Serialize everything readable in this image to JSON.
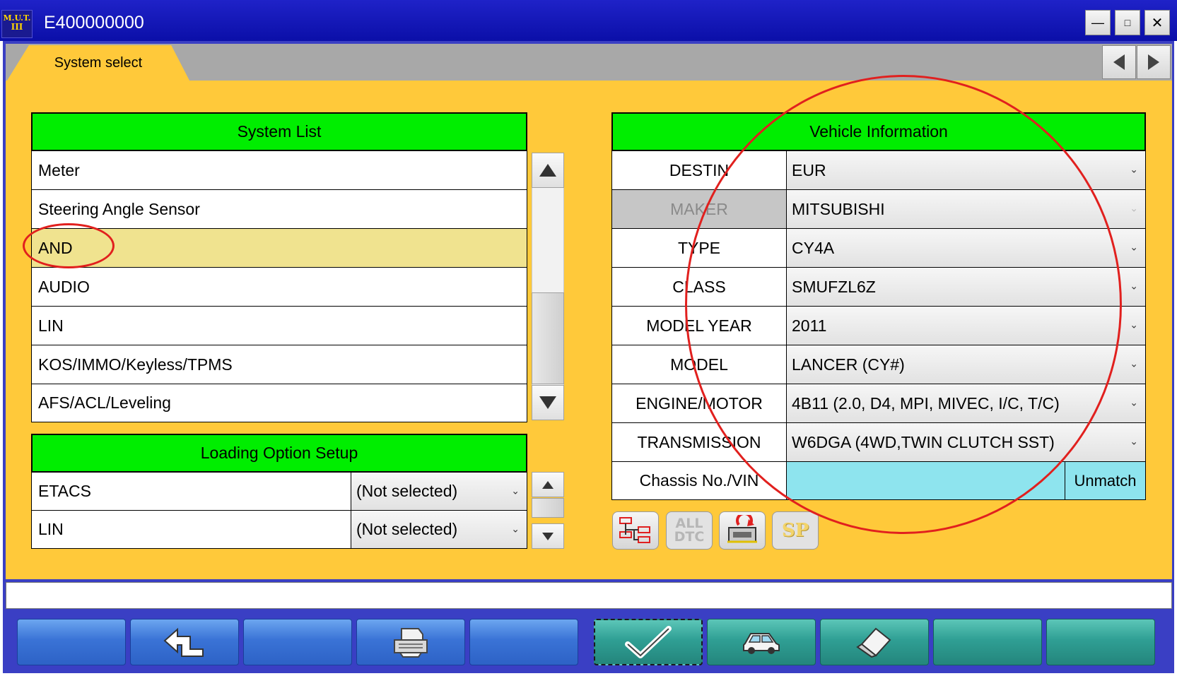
{
  "window": {
    "icon_text_line1": "M.U.T.",
    "icon_text_line2": "III",
    "title": "E400000000",
    "minimize": "—",
    "maximize": "□",
    "close": "✕"
  },
  "tab": {
    "label": "System select"
  },
  "system_list": {
    "header": "System List",
    "items": [
      {
        "label": "Meter"
      },
      {
        "label": "Steering Angle Sensor"
      },
      {
        "label": "AND",
        "selected": true
      },
      {
        "label": "AUDIO"
      },
      {
        "label": "LIN"
      },
      {
        "label": "KOS/IMMO/Keyless/TPMS"
      },
      {
        "label": "AFS/ACL/Leveling"
      }
    ]
  },
  "loading_option": {
    "header": "Loading Option Setup",
    "rows": [
      {
        "label": "ETACS",
        "value": "(Not selected)"
      },
      {
        "label": "LIN",
        "value": "(Not selected)"
      }
    ]
  },
  "vehicle_info": {
    "header": "Vehicle Information",
    "fields": [
      {
        "label": "DESTIN",
        "value": "EUR"
      },
      {
        "label": "MAKER",
        "value": "MITSUBISHI",
        "disabled": true
      },
      {
        "label": "TYPE",
        "value": "CY4A"
      },
      {
        "label": "CLASS",
        "value": "SMUFZL6Z"
      },
      {
        "label": "MODEL YEAR",
        "value": "2011"
      },
      {
        "label": "MODEL",
        "value": "LANCER (CY#)"
      },
      {
        "label": "ENGINE/MOTOR",
        "value": "4B11 (2.0, D4, MPI, MIVEC, I/C, T/C)"
      },
      {
        "label": "TRANSMISSION",
        "value": "W6DGA (4WD,TWIN CLUTCH SST)"
      }
    ],
    "vin_label": "Chassis No./VIN",
    "vin_value": "",
    "unmatch_label": "Unmatch"
  },
  "tools": {
    "all_dtc_line1": "ALL",
    "all_dtc_line2": "DTC",
    "sp_label": "SP"
  },
  "status_text": "",
  "colors": {
    "header_green": "#00ee00",
    "panel_yellow": "#ffc93a",
    "selected_row": "#f0e38f",
    "vin_cyan": "#8ee4ee",
    "annotation_red": "#e1201e"
  }
}
